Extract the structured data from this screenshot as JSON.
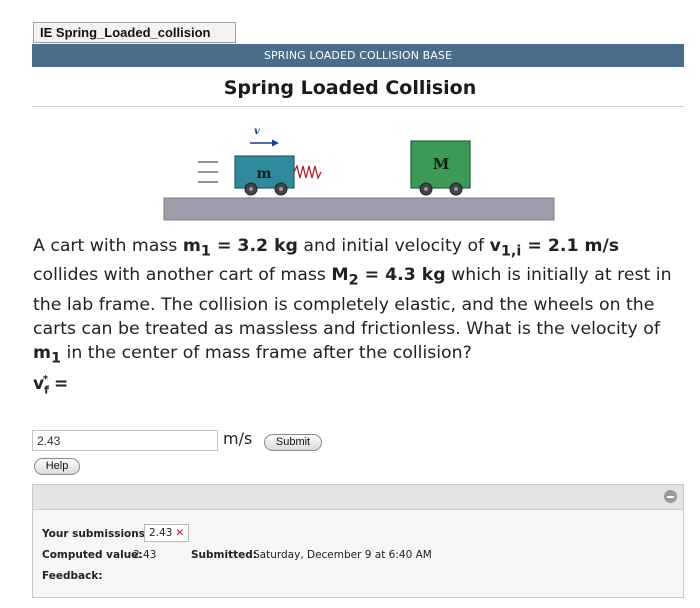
{
  "tab": {
    "label": "IE Spring_Loaded_collision"
  },
  "banner": {
    "text": "SPRING LOADED COLLISION BASE"
  },
  "page_title": "Spring Loaded Collision",
  "figure": {
    "velocity_label": "v",
    "cart1_label": "m",
    "cart2_label": "M",
    "colors": {
      "cart1": "#2f8b9b",
      "cart2": "#3c9a57",
      "ground": "#9e9eab"
    }
  },
  "problem": {
    "p1": "A cart with mass ",
    "m1_sym": "m",
    "m1_sub": "1",
    "m1_eq": " = 3.2 kg",
    "p2": " and initial velocity of ",
    "v1_sym": "v",
    "v1_sub": "1,i",
    "v1_eq": " = 2.1 m/s",
    "p3": " collides with another cart of mass ",
    "M2_sym": "M",
    "M2_sub": "2",
    "M2_eq": " = 4.3 kg",
    "p4": " which is initially at rest in the lab frame. The collision is completely elastic, and the wheels on the carts can be treated as massless and frictionless. What is the velocity of ",
    "m1b_sym": "m",
    "m1b_sub": "1",
    "p5": " in the center of mass frame after the collision?"
  },
  "answer_label": {
    "sym": "v",
    "sub": "f",
    "sup": "*",
    "eq": " ="
  },
  "answer_input": {
    "value": "2.43"
  },
  "unit": "m/s",
  "buttons": {
    "submit": "Submit",
    "help": "Help"
  },
  "feedback": {
    "submissions_label": "Your submissions:",
    "submission_value": "2.43",
    "submission_mark": "✕",
    "computed_label": "Computed value:",
    "computed_value": "2.43",
    "submitted_label": "Submitted:",
    "submitted_value": "Saturday, December 9 at 6:40 AM",
    "feedback_label": "Feedback:"
  }
}
